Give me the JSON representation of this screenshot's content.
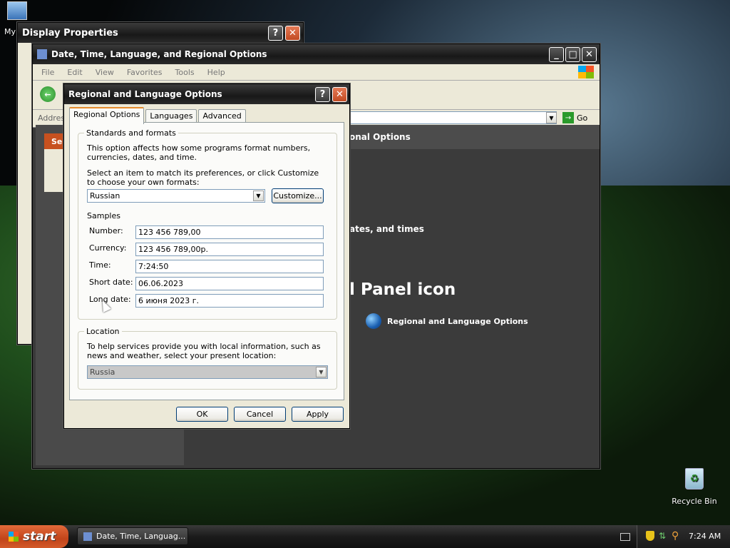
{
  "desktop": {
    "my_computer_label": "My",
    "recycle_label": "Recycle Bin"
  },
  "display_window": {
    "title": "Display Properties"
  },
  "cp_window": {
    "title": "Date, Time, Language, and Regional Options",
    "menu": [
      "File",
      "Edit",
      "View",
      "Favorites",
      "Tools",
      "Help"
    ],
    "address_label": "Addres",
    "go_label": "Go",
    "header_text": "onal Options",
    "link_dates": "ates, and times",
    "panel_heading": "l Panel icon",
    "regional_link": "Regional and Language Options",
    "left_tab": "Se"
  },
  "dialog": {
    "title": "Regional and Language Options",
    "tabs": [
      "Regional Options",
      "Languages",
      "Advanced"
    ],
    "standards": {
      "legend": "Standards and formats",
      "desc": "This option affects how some programs format numbers, currencies, dates, and time.",
      "select_prompt": "Select an item to match its preferences, or click Customize to choose your own formats:",
      "format_value": "Russian",
      "customize_label": "Customize...",
      "samples_label": "Samples",
      "samples": [
        {
          "label": "Number:",
          "value": "123 456 789,00"
        },
        {
          "label": "Currency:",
          "value": "123 456 789,00р."
        },
        {
          "label": "Time:",
          "value": "7:24:50"
        },
        {
          "label": "Short date:",
          "value": "06.06.2023"
        },
        {
          "label": "Long date:",
          "value": "6 июня 2023 г."
        }
      ]
    },
    "location": {
      "legend": "Location",
      "desc": "To help services provide you with local information, such as news and weather, select your present location:",
      "value": "Russia"
    },
    "buttons": {
      "ok": "OK",
      "cancel": "Cancel",
      "apply": "Apply"
    }
  },
  "taskbar": {
    "start_label": "start",
    "task_label": "Date, Time, Languag...",
    "clock": "7:24 AM"
  }
}
